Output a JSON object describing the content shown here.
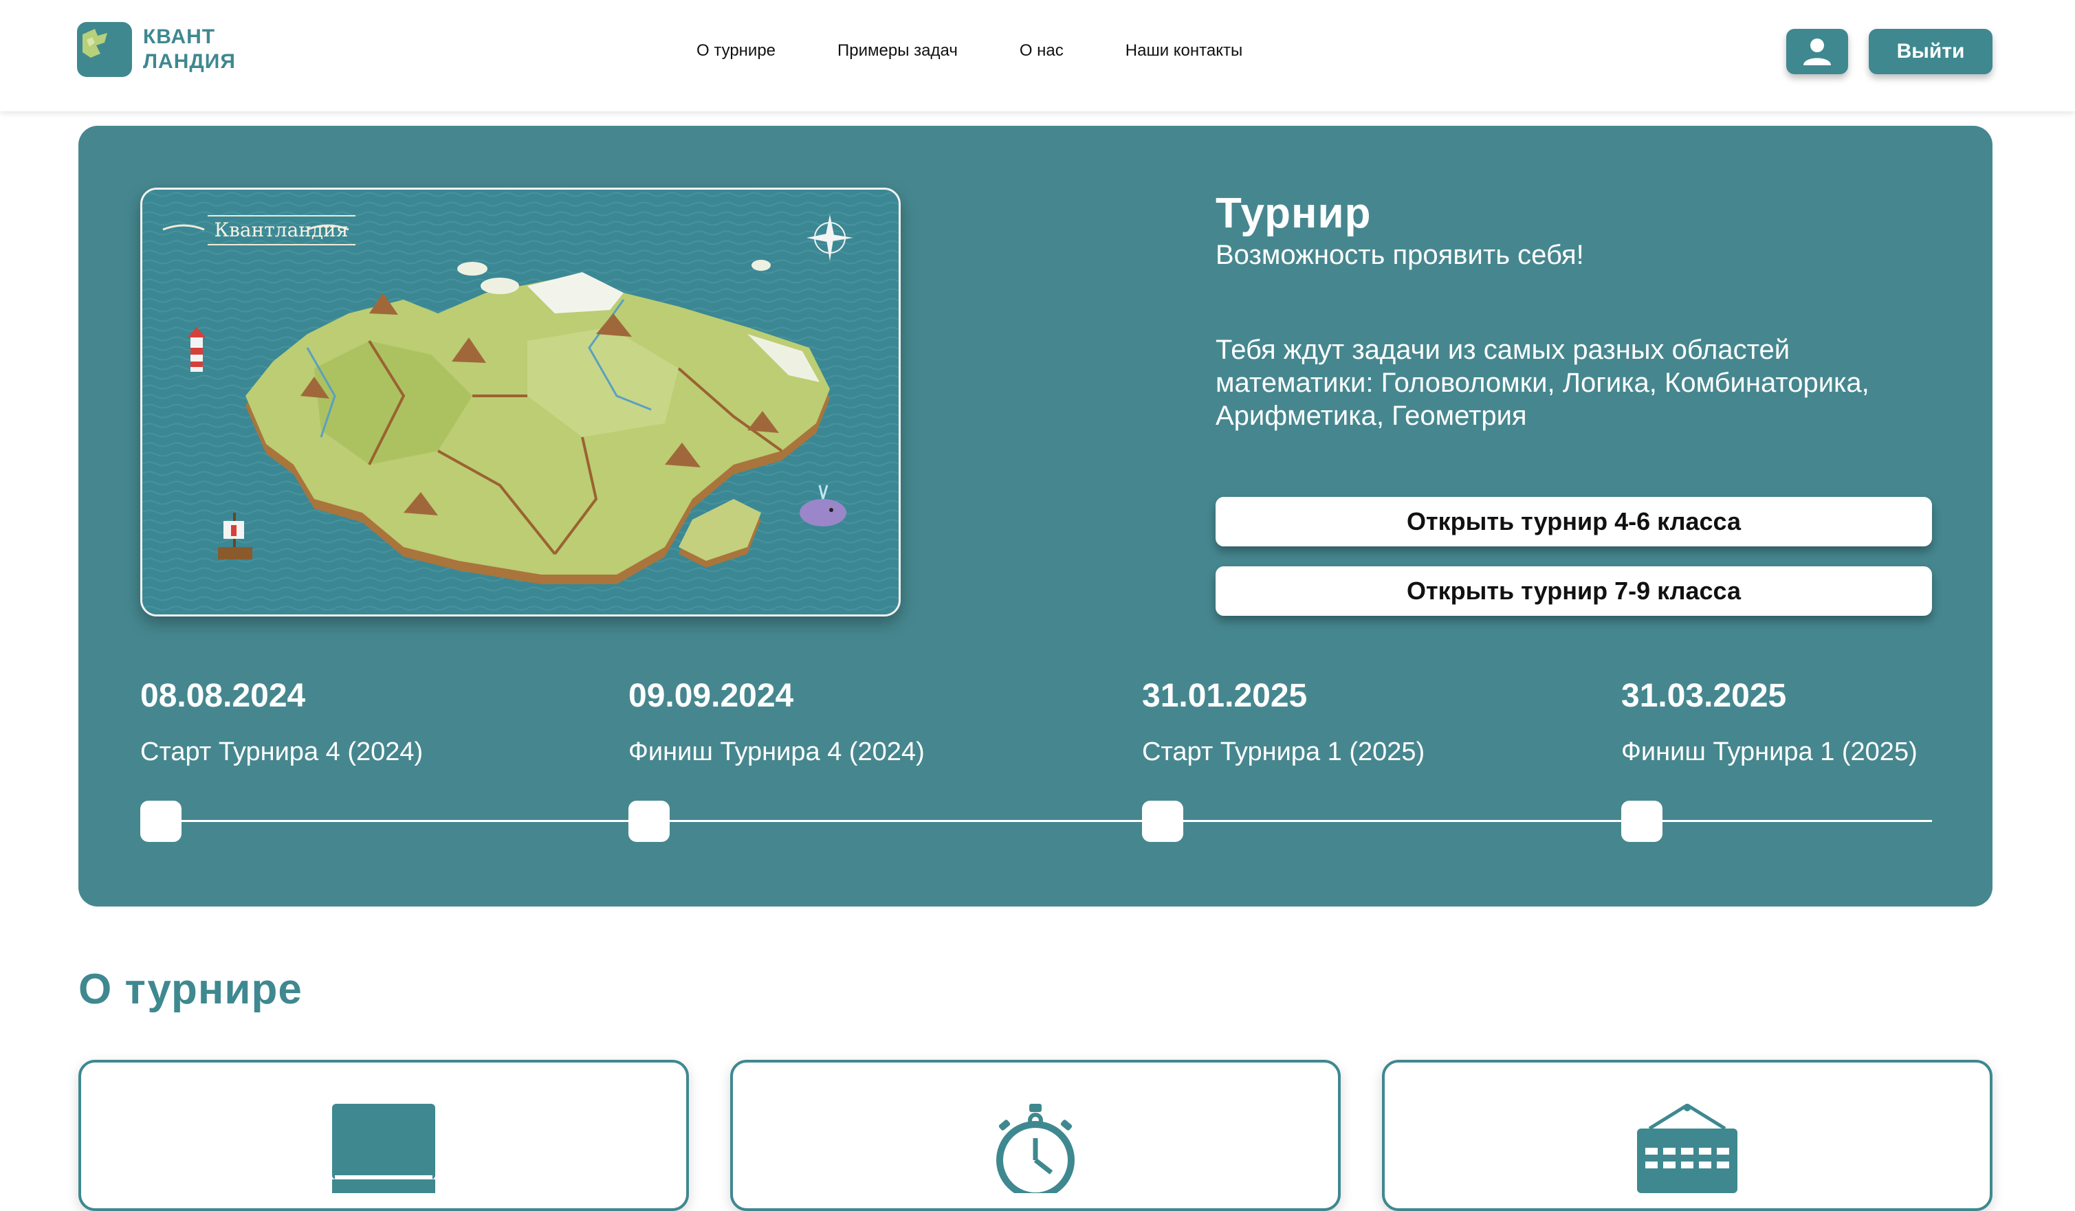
{
  "brand": {
    "line1": "КВАНТ",
    "line2": "ЛАНДИЯ"
  },
  "nav": {
    "items": [
      {
        "label": "О турнире"
      },
      {
        "label": "Примеры задач"
      },
      {
        "label": "О нас"
      },
      {
        "label": "Наши контакты"
      }
    ]
  },
  "header": {
    "logout_label": "Выйти",
    "user_icon": "user-icon"
  },
  "hero": {
    "map_title": "Квантландия",
    "title": "Турнир",
    "subtitle": "Возможность проявить себя!",
    "description": "Тебя ждут задачи из самых разных областей математики: Головоломки, Логика, Комбинаторика, Арифметика, Геометрия",
    "buttons": [
      {
        "label": "Открыть турнир 4-6 класса"
      },
      {
        "label": "Открыть турнир 7-9 класса"
      }
    ]
  },
  "timeline": [
    {
      "date": "08.08.2024",
      "label": "Старт Турнира 4 (2024)"
    },
    {
      "date": "09.09.2024",
      "label": "Финиш Турнира 4 (2024)"
    },
    {
      "date": "31.01.2025",
      "label": "Старт Турнира 1 (2025)"
    },
    {
      "date": "31.03.2025",
      "label": "Финиш Турнира 1 (2025)"
    }
  ],
  "about": {
    "title": "О турнире",
    "cards": [
      {
        "icon": "book-icon"
      },
      {
        "icon": "stopwatch-icon"
      },
      {
        "icon": "calendar-icon"
      }
    ]
  },
  "colors": {
    "accent": "#3f8890",
    "hero_bg": "#46878f",
    "white": "#ffffff"
  }
}
